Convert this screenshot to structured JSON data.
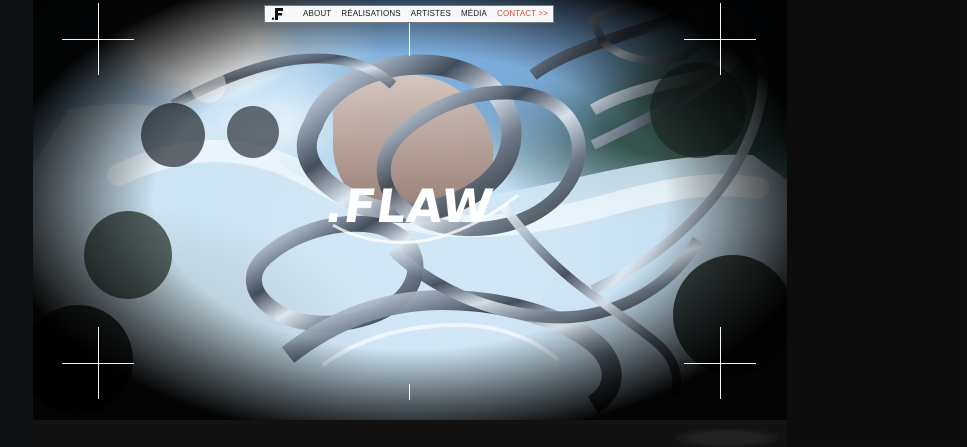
{
  "nav": {
    "logo_text": ".F",
    "items": [
      {
        "label": "ABOUT"
      },
      {
        "label": "RÉALISATIONS"
      },
      {
        "label": "ARTISTES"
      },
      {
        "label": "MÉDIA"
      },
      {
        "label": "CONTACT >>"
      }
    ]
  },
  "hero": {
    "brand": ".FLAW"
  },
  "colors": {
    "contact_accent": "#d24b38",
    "background": "#0b0b0c",
    "sky_blue": "#8ebfe4",
    "chrome_white": "#ffffff"
  },
  "icons": {
    "logo": "flaw-logo-icon",
    "crosshair": "crosshair-icon"
  }
}
